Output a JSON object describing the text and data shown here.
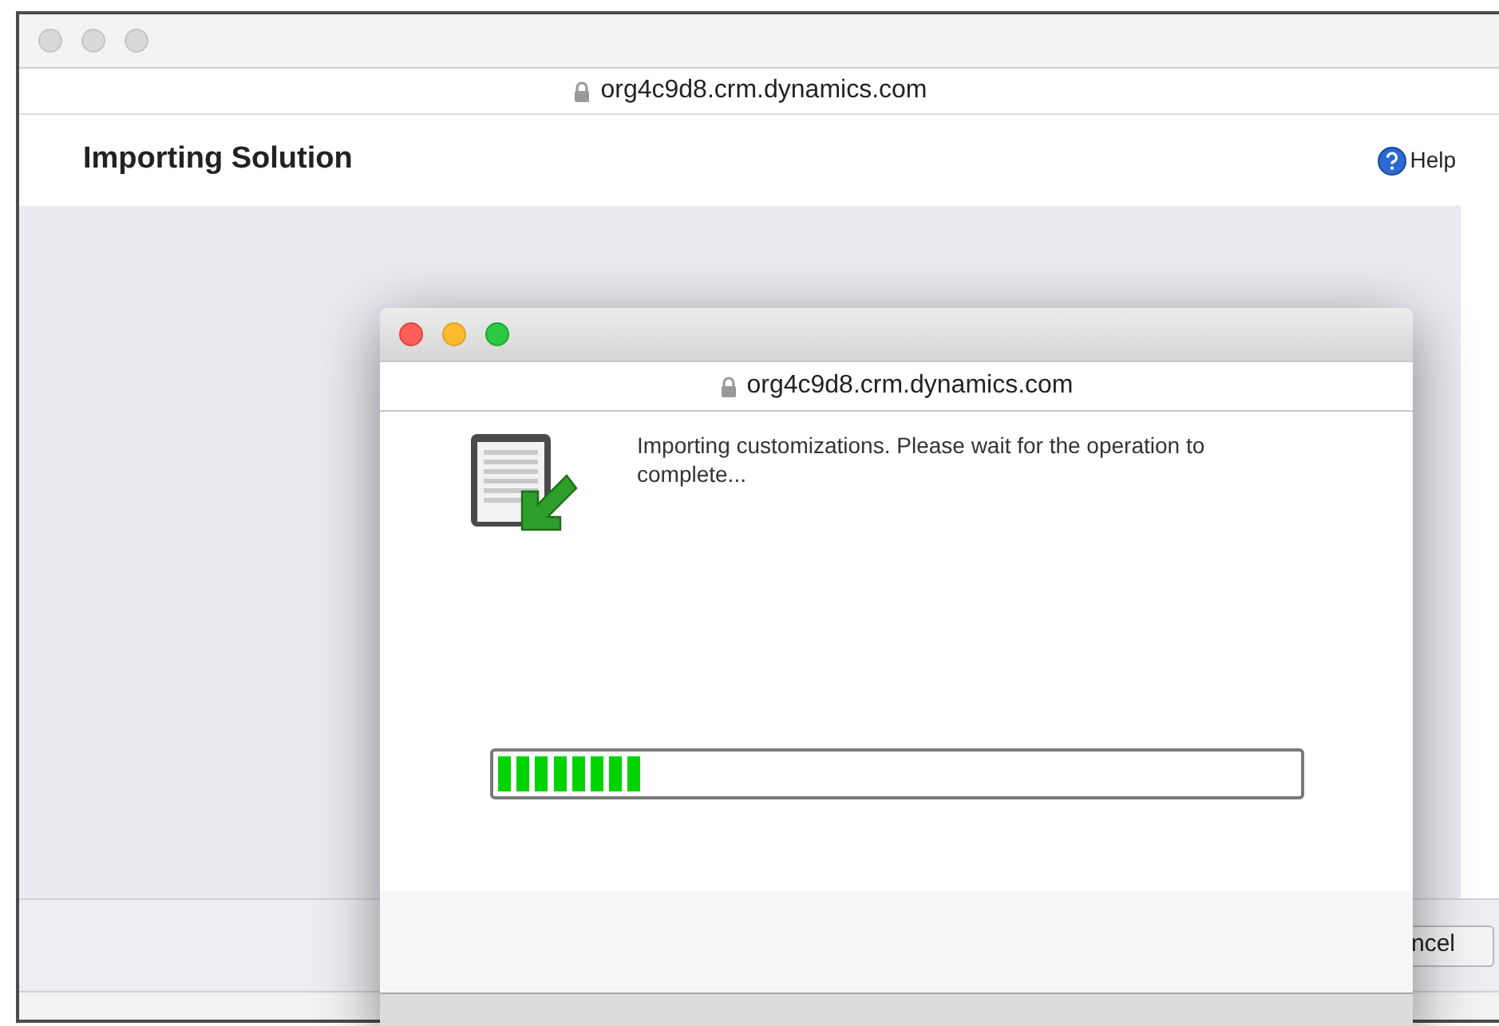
{
  "window": {
    "address": "org4c9d8.crm.dynamics.com"
  },
  "page": {
    "title": "Importing Solution",
    "help": "Help",
    "footer_button": "ncel"
  },
  "dialog": {
    "address": "org4c9d8.crm.dynamics.com",
    "message": "Importing customizations. Please wait for the operation to complete...",
    "progress": {
      "level": 0.18
    }
  }
}
